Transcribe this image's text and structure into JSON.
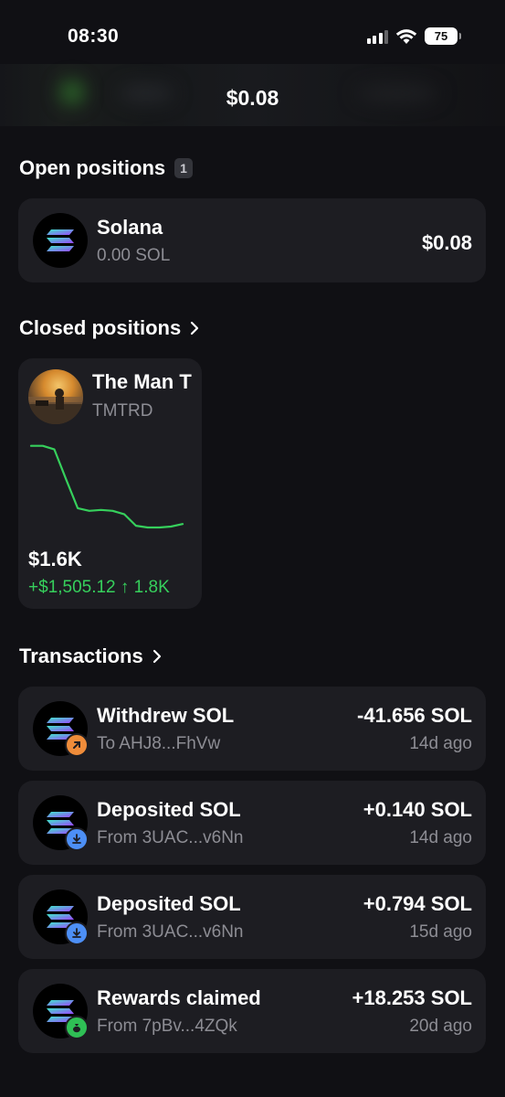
{
  "status_bar": {
    "time": "08:30",
    "battery": "75"
  },
  "header": {
    "balance": "$0.08"
  },
  "open_positions": {
    "title": "Open positions",
    "count": "1",
    "items": [
      {
        "name": "Solana",
        "amount": "0.00 SOL",
        "value": "$0.08"
      }
    ]
  },
  "closed_positions": {
    "title": "Closed positions",
    "items": [
      {
        "name": "The Man T",
        "symbol": "TMTRD",
        "value": "$1.6K",
        "pnl": "+$1,505.12 ↑ 1.8K",
        "sparkline": [
          0.93,
          0.93,
          0.89,
          0.55,
          0.22,
          0.19,
          0.2,
          0.19,
          0.15,
          0.02,
          0.0,
          0.0,
          0.01,
          0.04
        ]
      }
    ]
  },
  "transactions": {
    "title": "Transactions",
    "items": [
      {
        "title": "Withdrew SOL",
        "subtitle": "To AHJ8...FhVw",
        "amount": "-41.656 SOL",
        "time": "14d ago",
        "badge": "arrow-up-right-icon",
        "badge_color": "#ef8c3a"
      },
      {
        "title": "Deposited SOL",
        "subtitle": "From 3UAC...v6Nn",
        "amount": "+0.140 SOL",
        "time": "14d ago",
        "badge": "download-icon",
        "badge_color": "#4d8ff5"
      },
      {
        "title": "Deposited SOL",
        "subtitle": "From 3UAC...v6Nn",
        "amount": "+0.794 SOL",
        "time": "15d ago",
        "badge": "download-icon",
        "badge_color": "#4d8ff5"
      },
      {
        "title": "Rewards claimed",
        "subtitle": "From 7pBv...4ZQk",
        "amount": "+18.253 SOL",
        "time": "20d ago",
        "badge": "money-bag-icon",
        "badge_color": "#2fbf55"
      }
    ]
  },
  "colors": {
    "background": "#101014",
    "card": "#1d1d22",
    "positive": "#36d05c",
    "muted": "#8d8d94"
  }
}
